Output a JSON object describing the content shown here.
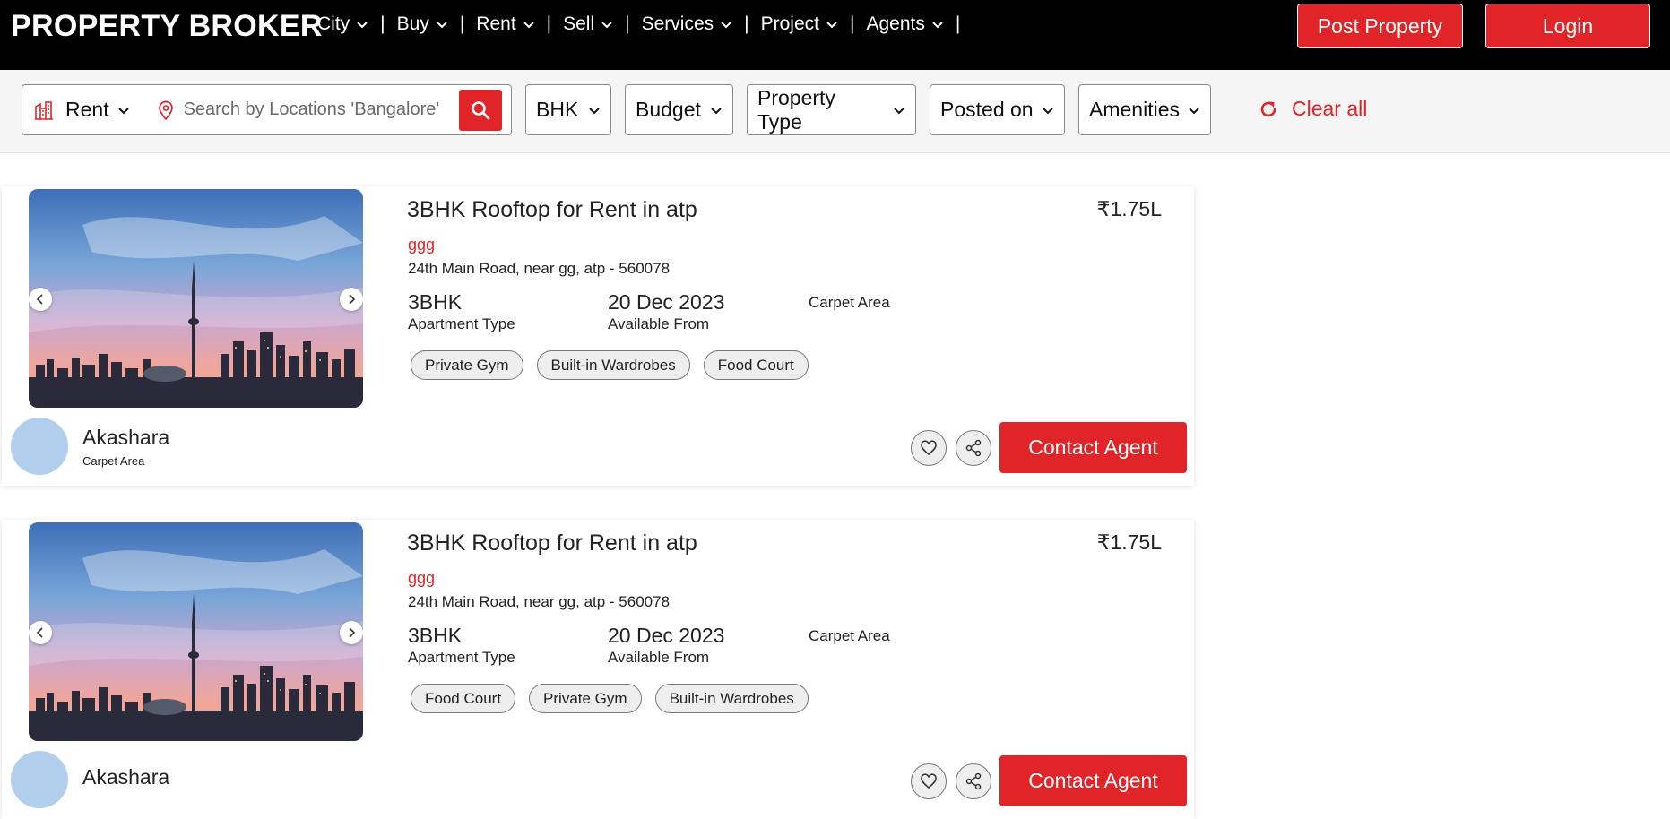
{
  "header": {
    "brand": "PROPERTY BROKER",
    "nav": [
      {
        "label": "City"
      },
      {
        "label": "Buy"
      },
      {
        "label": "Rent"
      },
      {
        "label": "Sell"
      },
      {
        "label": "Services"
      },
      {
        "label": "Project"
      },
      {
        "label": "Agents"
      }
    ],
    "separator": "|",
    "post_property": "Post Property",
    "login": "Login"
  },
  "filters": {
    "mode": "Rent",
    "search_placeholder": "Search by Locations 'Bangalore'",
    "bhk": "BHK",
    "budget": "Budget",
    "property_type": "Property Type",
    "posted_on": "Posted on",
    "amenities": "Amenities",
    "clear_all": "Clear all"
  },
  "listings": [
    {
      "title": "3BHK Rooftop for Rent in atp",
      "price": "₹1.75L",
      "subtitle": "ggg",
      "address": "24th Main Road, near gg, atp - 560078",
      "apartment_value": "3BHK",
      "apartment_label": "Apartment Type",
      "available_value": "20 Dec 2023",
      "available_label": "Available From",
      "carpet_label": "Carpet Area",
      "tags": [
        "Private Gym",
        "Built-in Wardrobes",
        "Food Court"
      ],
      "agent_name": "Akashara",
      "agent_sub": "Carpet Area",
      "contact": "Contact Agent"
    },
    {
      "title": "3BHK Rooftop for Rent in atp",
      "price": "₹1.75L",
      "subtitle": "ggg",
      "address": "24th Main Road, near gg, atp - 560078",
      "apartment_value": "3BHK",
      "apartment_label": "Apartment Type",
      "available_value": "20 Dec 2023",
      "available_label": "Available From",
      "carpet_label": "Carpet Area",
      "tags": [
        "Food Court",
        "Private Gym",
        "Built-in Wardrobes"
      ],
      "agent_name": "Akashara",
      "agent_sub": "",
      "contact": "Contact Agent"
    }
  ],
  "colors": {
    "accent": "#e02427",
    "header_bg": "#000000",
    "filter_bg": "#f5f5f5",
    "avatar": "#b1cfec"
  }
}
